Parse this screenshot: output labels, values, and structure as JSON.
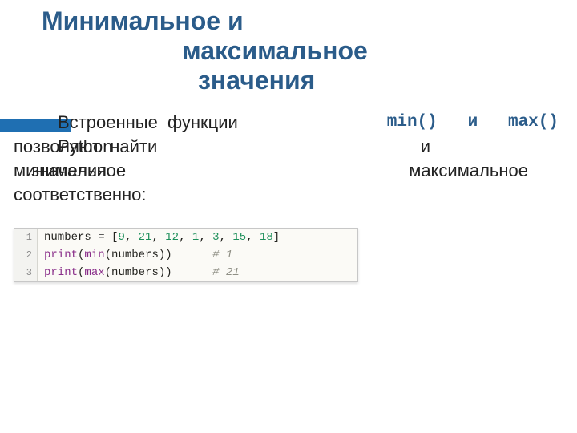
{
  "title": {
    "line1": "Минимальное   и",
    "line2": "максимальное",
    "line3": "значения"
  },
  "body": {
    "r1_left": "Встроенные  функции",
    "r1_keywords": "min()   и   max()",
    "r2_under": "Python",
    "r2_over": "позволяют  найти",
    "r2_right": "и",
    "r3_under": "значения",
    "r3_over": "минимальное",
    "r3_right": "максимальное",
    "r4": "соответственно:"
  },
  "code": {
    "lines": [
      {
        "n": "1",
        "tokens": [
          {
            "c": "c-var",
            "t": "numbers"
          },
          {
            "c": "c-op",
            "t": " = "
          },
          {
            "c": "c-pun",
            "t": "["
          },
          {
            "c": "c-num",
            "t": "9"
          },
          {
            "c": "c-pun",
            "t": ", "
          },
          {
            "c": "c-num",
            "t": "21"
          },
          {
            "c": "c-pun",
            "t": ", "
          },
          {
            "c": "c-num",
            "t": "12"
          },
          {
            "c": "c-pun",
            "t": ", "
          },
          {
            "c": "c-num",
            "t": "1"
          },
          {
            "c": "c-pun",
            "t": ", "
          },
          {
            "c": "c-num",
            "t": "3"
          },
          {
            "c": "c-pun",
            "t": ", "
          },
          {
            "c": "c-num",
            "t": "15"
          },
          {
            "c": "c-pun",
            "t": ", "
          },
          {
            "c": "c-num",
            "t": "18"
          },
          {
            "c": "c-pun",
            "t": "]"
          }
        ]
      },
      {
        "n": "2",
        "tokens": [
          {
            "c": "c-bi",
            "t": "print"
          },
          {
            "c": "c-pun",
            "t": "("
          },
          {
            "c": "c-bi",
            "t": "min"
          },
          {
            "c": "c-pun",
            "t": "("
          },
          {
            "c": "c-var",
            "t": "numbers"
          },
          {
            "c": "c-pun",
            "t": "))"
          },
          {
            "c": "c-var",
            "t": "      "
          },
          {
            "c": "c-cmt",
            "t": "# 1"
          }
        ]
      },
      {
        "n": "3",
        "tokens": [
          {
            "c": "c-bi",
            "t": "print"
          },
          {
            "c": "c-pun",
            "t": "("
          },
          {
            "c": "c-bi",
            "t": "max"
          },
          {
            "c": "c-pun",
            "t": "("
          },
          {
            "c": "c-var",
            "t": "numbers"
          },
          {
            "c": "c-pun",
            "t": "))"
          },
          {
            "c": "c-var",
            "t": "      "
          },
          {
            "c": "c-cmt",
            "t": "# 21"
          }
        ]
      }
    ]
  }
}
